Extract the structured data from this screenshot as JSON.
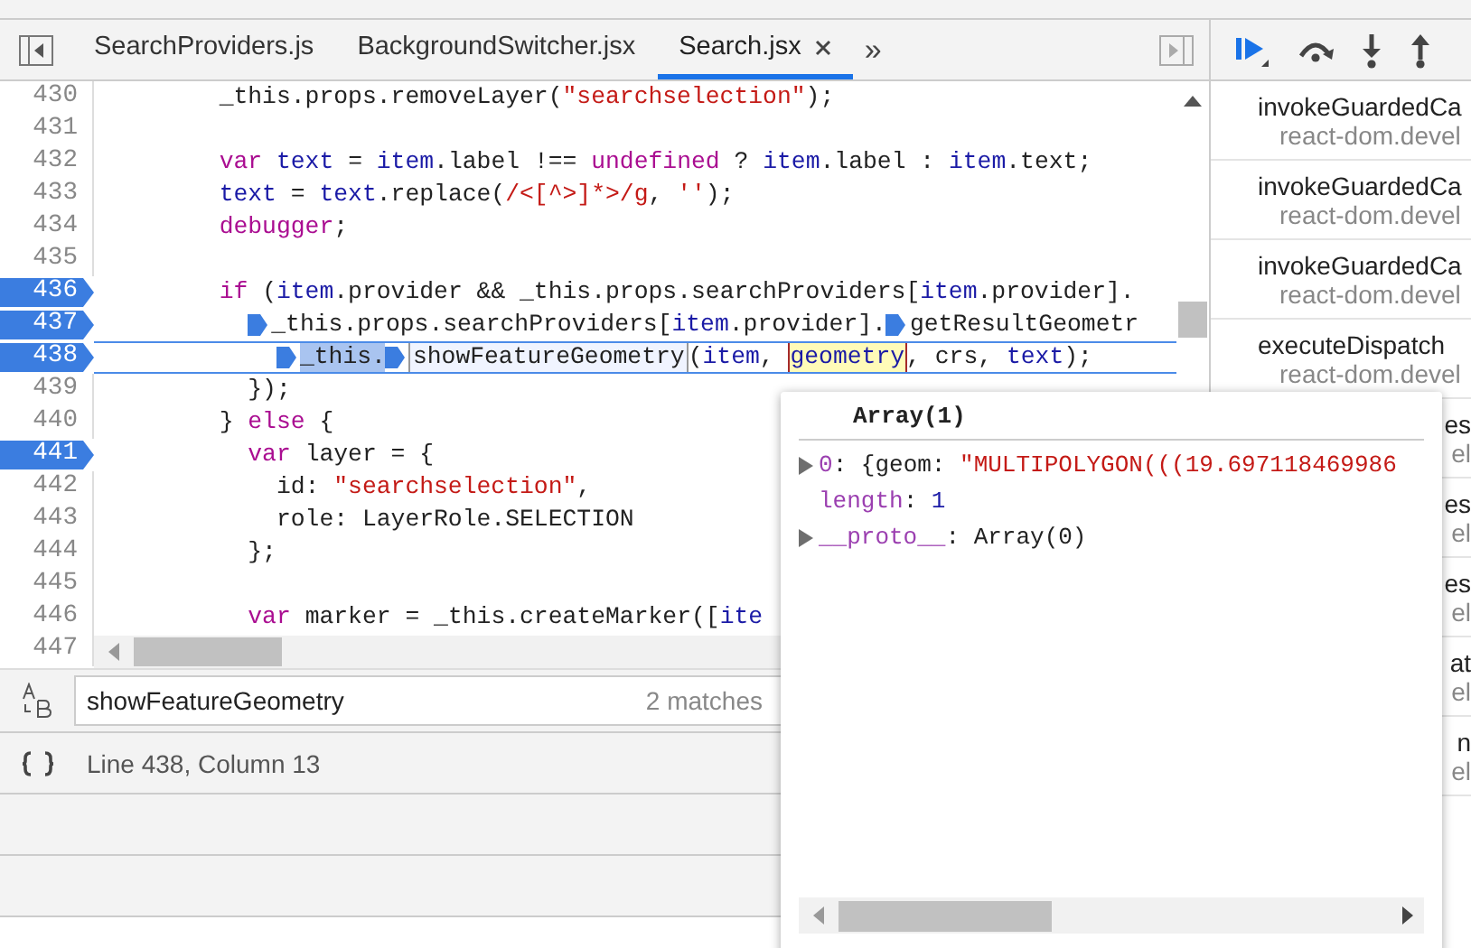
{
  "tabs": [
    {
      "label": "SearchProviders.js",
      "selected": false,
      "closable": false
    },
    {
      "label": "BackgroundSwitcher.jsx",
      "selected": false,
      "closable": false
    },
    {
      "label": "Search.jsx",
      "selected": true,
      "closable": true
    }
  ],
  "more_tabs": "»",
  "lines": [
    {
      "number": "430",
      "breakpoint": false,
      "current": false,
      "tokens": [
        {
          "kind": "plain",
          "text": "        _this.props.removeLayer("
        },
        {
          "kind": "string",
          "text": "\"searchselection\""
        },
        {
          "kind": "plain",
          "text": ");"
        }
      ]
    },
    {
      "number": "431",
      "breakpoint": false,
      "current": false
    },
    {
      "number": "432",
      "breakpoint": false,
      "current": false,
      "tokens": [
        {
          "kind": "keyword",
          "text": "        var"
        },
        {
          "kind": "variable",
          "text": " text"
        },
        {
          "kind": "plain",
          "text": " = "
        },
        {
          "kind": "variable",
          "text": "item"
        },
        {
          "kind": "plain",
          "text": ".label !== "
        },
        {
          "kind": "keyword",
          "text": "undefined"
        },
        {
          "kind": "plain",
          "text": " ? "
        },
        {
          "kind": "variable",
          "text": "item"
        },
        {
          "kind": "plain",
          "text": ".label : "
        },
        {
          "kind": "variable",
          "text": "item"
        },
        {
          "kind": "plain",
          "text": ".text;"
        }
      ]
    },
    {
      "number": "433",
      "breakpoint": false,
      "current": false,
      "tokens": [
        {
          "kind": "variable",
          "text": "        text"
        },
        {
          "kind": "plain",
          "text": " = "
        },
        {
          "kind": "variable",
          "text": "text"
        },
        {
          "kind": "plain",
          "text": ".replace("
        },
        {
          "kind": "string",
          "text": "/<[^>]*>/g"
        },
        {
          "kind": "plain",
          "text": ", "
        },
        {
          "kind": "string",
          "text": "''"
        },
        {
          "kind": "plain",
          "text": ");"
        }
      ]
    },
    {
      "number": "434",
      "breakpoint": false,
      "current": false,
      "tokens": [
        {
          "kind": "keyword",
          "text": "        debugger"
        },
        {
          "kind": "plain",
          "text": ";"
        }
      ]
    },
    {
      "number": "435",
      "breakpoint": false,
      "current": false
    },
    {
      "number": "436",
      "breakpoint": true,
      "current": false,
      "tokens": [
        {
          "kind": "keyword",
          "text": "        if"
        },
        {
          "kind": "plain",
          "text": " ("
        },
        {
          "kind": "variable",
          "text": "item"
        },
        {
          "kind": "plain",
          "text": ".provider && _this.props.searchProviders["
        },
        {
          "kind": "variable",
          "text": "item"
        },
        {
          "kind": "plain",
          "text": ".provider]."
        }
      ]
    },
    {
      "number": "437",
      "breakpoint": true,
      "current": false,
      "tokens": [
        {
          "kind": "plain",
          "text": "          _this.props.searchProviders[",
          "marker": true
        },
        {
          "kind": "variable",
          "text": "item"
        },
        {
          "kind": "plain",
          "text": ".provider]."
        },
        {
          "kind": "plain",
          "text": "getResultGeometr",
          "marker": true
        }
      ]
    },
    {
      "number": "438",
      "breakpoint": true,
      "current": true,
      "tokens": [
        {
          "kind": "selected",
          "text": "            _this.",
          "marker": true
        },
        {
          "kind": "match",
          "text": "showFeatureGeometry",
          "marker": true
        },
        {
          "kind": "plain",
          "text": "("
        },
        {
          "kind": "variable",
          "text": "item"
        },
        {
          "kind": "plain",
          "text": ", "
        },
        {
          "kind": "hover",
          "text": "geometry"
        },
        {
          "kind": "plain",
          "text": ", crs, "
        },
        {
          "kind": "variable",
          "text": "text"
        },
        {
          "kind": "plain",
          "text": ");"
        }
      ]
    },
    {
      "number": "439",
      "breakpoint": false,
      "current": false,
      "tokens": [
        {
          "kind": "plain",
          "text": "          });"
        }
      ]
    },
    {
      "number": "440",
      "breakpoint": false,
      "current": false,
      "tokens": [
        {
          "kind": "plain",
          "text": "        } "
        },
        {
          "kind": "keyword",
          "text": "else"
        },
        {
          "kind": "plain",
          "text": " {"
        }
      ]
    },
    {
      "number": "441",
      "breakpoint": true,
      "current": false,
      "tokens": [
        {
          "kind": "keyword",
          "text": "          var"
        },
        {
          "kind": "plain",
          "text": " layer = {"
        }
      ]
    },
    {
      "number": "442",
      "breakpoint": false,
      "current": false,
      "tokens": [
        {
          "kind": "plain",
          "text": "            id: "
        },
        {
          "kind": "string",
          "text": "\"searchselection\""
        },
        {
          "kind": "plain",
          "text": ","
        }
      ]
    },
    {
      "number": "443",
      "breakpoint": false,
      "current": false,
      "tokens": [
        {
          "kind": "plain",
          "text": "            role: LayerRole.SELECTION"
        }
      ]
    },
    {
      "number": "444",
      "breakpoint": false,
      "current": false,
      "tokens": [
        {
          "kind": "plain",
          "text": "          };"
        }
      ]
    },
    {
      "number": "445",
      "breakpoint": false,
      "current": false
    },
    {
      "number": "446",
      "breakpoint": false,
      "current": false,
      "tokens": [
        {
          "kind": "keyword",
          "text": "          var"
        },
        {
          "kind": "plain",
          "text": " marker = _this.createMarker(["
        },
        {
          "kind": "variable",
          "text": "ite"
        }
      ]
    },
    {
      "number": "447",
      "breakpoint": false,
      "current": false
    }
  ],
  "search": {
    "value": "showFeatureGeometry",
    "matches": "2 matches"
  },
  "status_bar": {
    "position": "Line 438, Column 13"
  },
  "popover": {
    "title": "Array(1)",
    "rows": [
      {
        "expandable": true,
        "key": "0",
        "value": ": {geom: ",
        "string": "\"MULTIPOLYGON(((19.697118469986"
      },
      {
        "expandable": false,
        "key": "length",
        "value": ": ",
        "number": "1"
      },
      {
        "expandable": true,
        "key": "__proto__",
        "value": ": Array(0)"
      }
    ]
  },
  "call_stack": [
    {
      "name": "invokeGuardedCa",
      "file": "react-dom.devel",
      "kind": "full"
    },
    {
      "name": "invokeGuardedCa",
      "file": "react-dom.devel",
      "kind": "full"
    },
    {
      "name": "invokeGuardedCa",
      "file": "react-dom.devel",
      "kind": "full"
    },
    {
      "name": "executeDispatch",
      "file": "react-dom.devel",
      "kind": "full"
    },
    {
      "name": "es",
      "file": "el",
      "kind": "cut"
    },
    {
      "name": "es",
      "file": "el",
      "kind": "cut"
    },
    {
      "name": "es",
      "file": "el",
      "kind": "cut"
    },
    {
      "name": "at",
      "file": "el",
      "kind": "cut"
    },
    {
      "name": "n",
      "file": "el",
      "kind": "cut"
    }
  ]
}
